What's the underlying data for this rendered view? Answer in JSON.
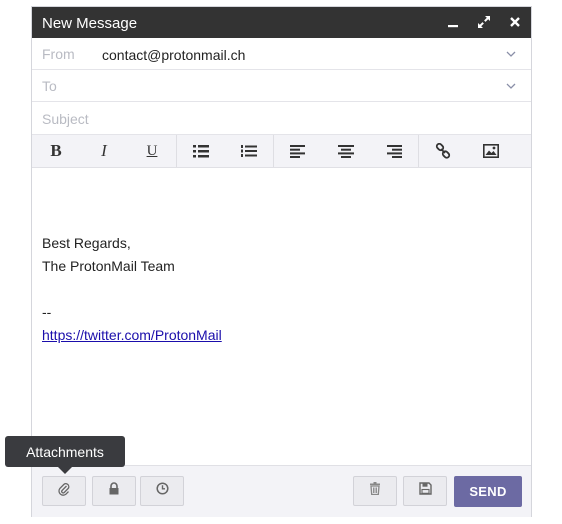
{
  "window": {
    "title": "New Message"
  },
  "fields": {
    "from_label": "From",
    "from_value": "contact@protonmail.ch",
    "to_label": "To",
    "subject_label": "Subject"
  },
  "toolbar": {
    "bold": "B",
    "italic": "I",
    "underline": "U"
  },
  "body": {
    "line1": "Best Regards,",
    "line2": "The ProtonMail Team",
    "line3": "--",
    "link": "https://twitter.com/ProtonMail"
  },
  "footer": {
    "send_label": "SEND",
    "tooltip": "Attachments"
  },
  "icons": [
    "minimize-icon",
    "expand-icon",
    "close-icon",
    "chevron-down-icon",
    "bold-icon",
    "italic-icon",
    "underline-icon",
    "bulleted-list-icon",
    "numbered-list-icon",
    "align-left-icon",
    "align-center-icon",
    "align-right-icon",
    "link-icon",
    "image-icon",
    "paperclip-icon",
    "lock-icon",
    "clock-icon",
    "trash-icon",
    "save-icon"
  ],
  "colors": {
    "titlebar": "#333333",
    "send": "#6c6aa3",
    "toolbar": "#f3f3f7"
  }
}
